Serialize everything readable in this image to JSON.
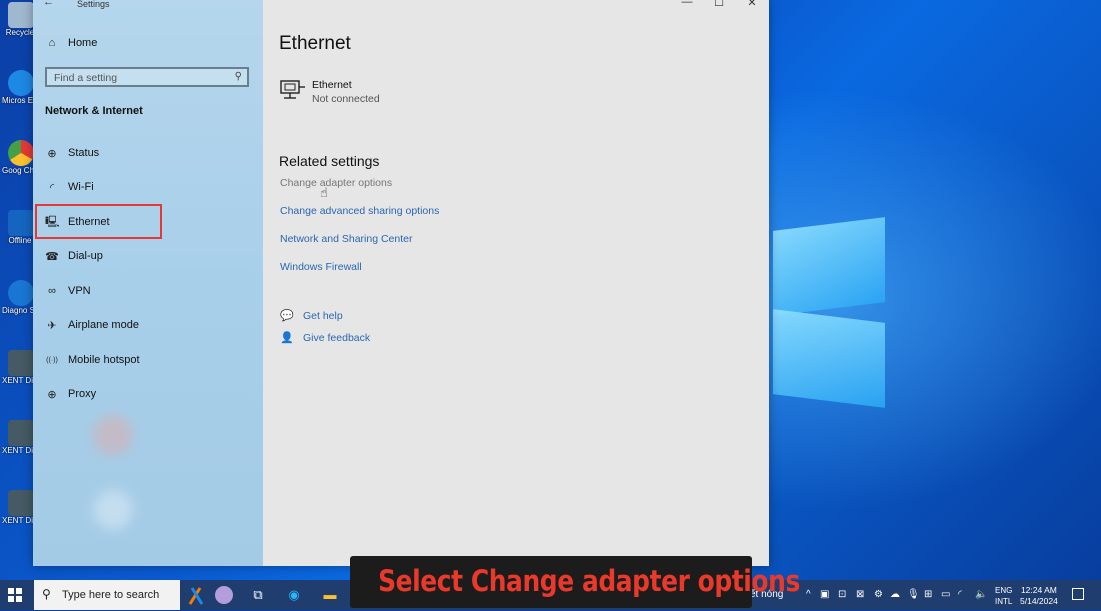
{
  "window": {
    "title": "Settings",
    "back_icon": "←",
    "minimize_icon": "—",
    "maximize_icon": "☐",
    "close_icon": "✕"
  },
  "sidebar": {
    "home_label": "Home",
    "search_placeholder": "Find a setting",
    "section": "Network & Internet",
    "items": [
      {
        "label": "Status",
        "icon": "globe-status-icon",
        "glyph": "⊕"
      },
      {
        "label": "Wi-Fi",
        "icon": "wifi-icon",
        "glyph": "◜"
      },
      {
        "label": "Ethernet",
        "icon": "ethernet-icon",
        "glyph": "🖳"
      },
      {
        "label": "Dial-up",
        "icon": "dialup-icon",
        "glyph": "☎"
      },
      {
        "label": "VPN",
        "icon": "vpn-icon",
        "glyph": "∞"
      },
      {
        "label": "Airplane mode",
        "icon": "airplane-icon",
        "glyph": "✈"
      },
      {
        "label": "Mobile hotspot",
        "icon": "hotspot-icon",
        "glyph": "((·))"
      },
      {
        "label": "Proxy",
        "icon": "proxy-globe-icon",
        "glyph": "⊕"
      }
    ]
  },
  "main": {
    "title": "Ethernet",
    "adapter_name": "Ethernet",
    "adapter_status": "Not connected",
    "related_title": "Related settings",
    "links": [
      "Change adapter options",
      "Change advanced sharing options",
      "Network and Sharing Center",
      "Windows Firewall"
    ],
    "get_help": "Get help",
    "give_feedback": "Give feedback"
  },
  "caption": "Select Change adapter options",
  "desktop_icons": [
    {
      "label": "Recycle",
      "color": "#9fb7cf"
    },
    {
      "label": "Micros Edge",
      "color": "#1e88e5"
    },
    {
      "label": "Goog Chro",
      "color": "#e53935"
    },
    {
      "label": "Offline",
      "color": "#1565c0"
    },
    {
      "label": "Diagno Stop",
      "color": "#1976d2"
    },
    {
      "label": "XENT Diagn",
      "color": "#455a64"
    },
    {
      "label": "XENT Diagn",
      "color": "#455a64"
    },
    {
      "label": "XENT Diagn",
      "color": "#455a64"
    }
  ],
  "taskbar": {
    "search_placeholder": "Type here to search",
    "weather_text": "ết nóng",
    "lang_line1": "ENG",
    "lang_line2": "INTL",
    "time": "12:24 AM",
    "date": "5/14/2024"
  },
  "colors": {
    "link": "#2a67b0",
    "highlight_box": "#e53935",
    "caption_text": "#e8392b"
  }
}
